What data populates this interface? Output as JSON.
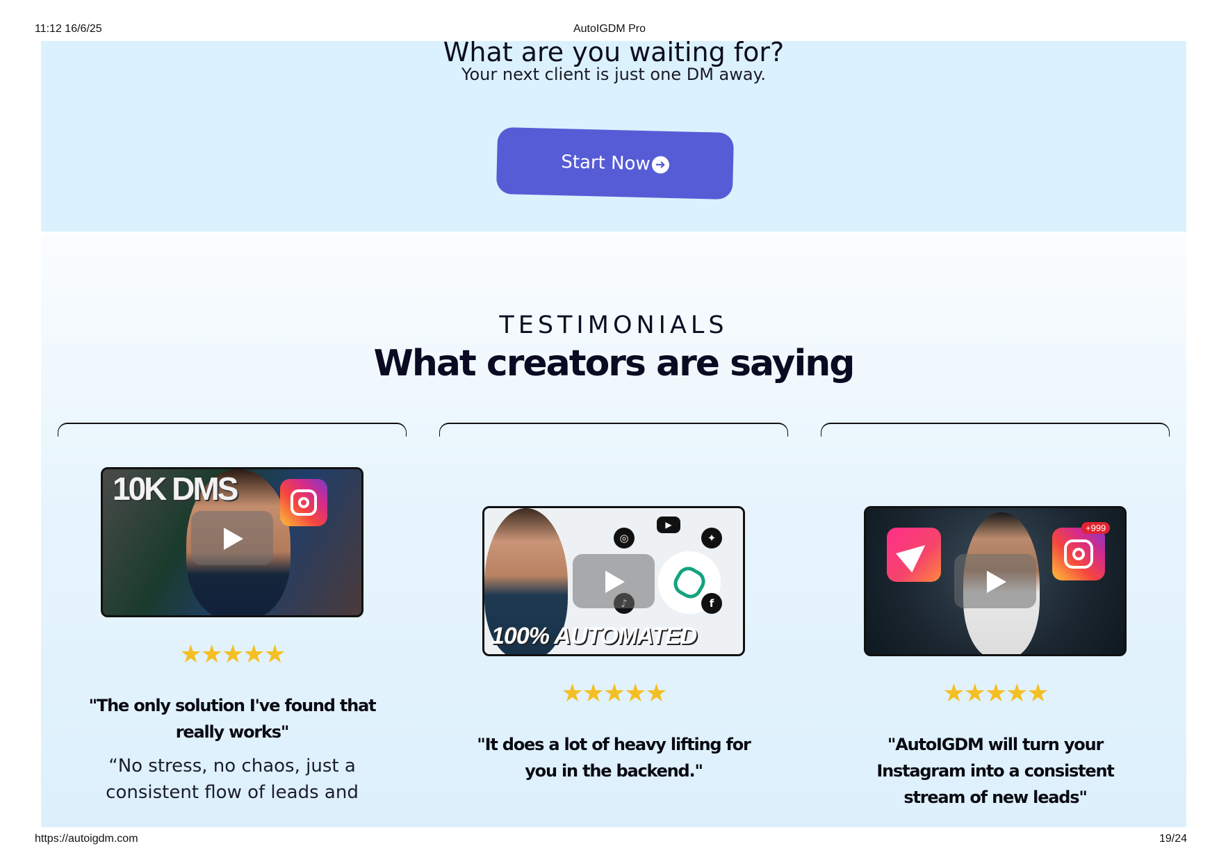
{
  "browser": {
    "datetime": "11:12 16/6/25",
    "title": "AutoIGDM Pro",
    "url": "https://autoigdm.com",
    "page": "19/24"
  },
  "cta": {
    "title": "What are you waiting for?",
    "subtitle": "Your next client is just one DM away.",
    "button_label": "Start Now",
    "button_icon": "arrow-right-circle-icon",
    "button_color": "#565cd6",
    "background": "#dbf1fd"
  },
  "testimonials": {
    "kicker": "TESTIMONIALS",
    "headline": "What creators are saying",
    "star_color": "#f4bf25",
    "cards": [
      {
        "thumbnail_text": "10K DMS",
        "stars": "★★★★★",
        "quote": "\"The only solution I've found that really works\"",
        "body": "“No stress, no chaos, just a consistent flow of leads and"
      },
      {
        "thumbnail_text": "100% AUTOMATED",
        "stars": "★★★★★",
        "quote": "\"It does a lot of heavy lifting for you in the backend.\""
      },
      {
        "thumbnail_text": "+999",
        "stars": "★★★★★",
        "quote": "\"AutoIGDM will turn your Instagram into a consistent stream of new leads\""
      }
    ]
  }
}
